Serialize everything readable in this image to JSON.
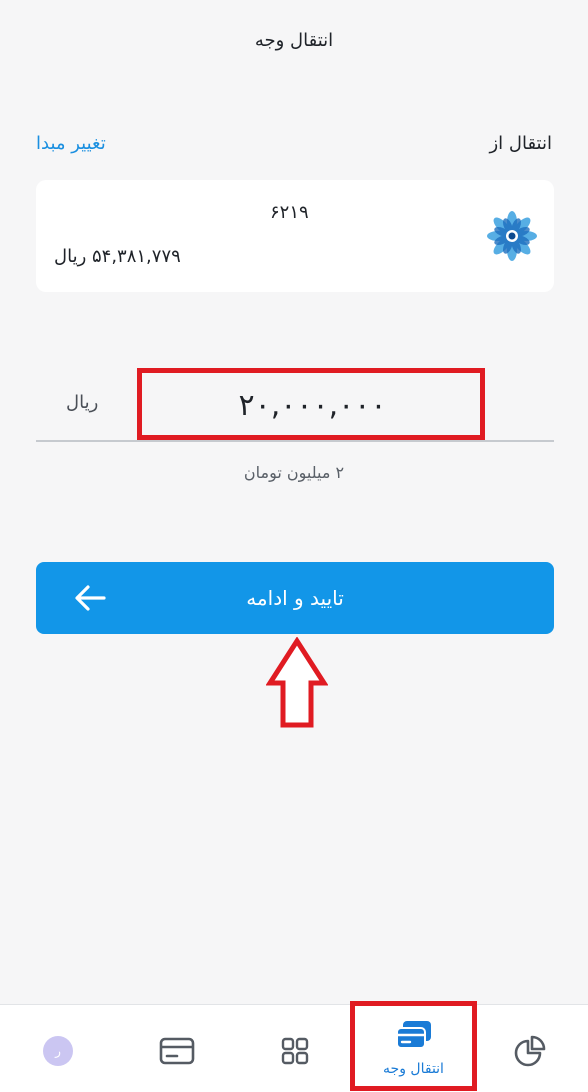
{
  "header": {
    "title": "انتقال وجه"
  },
  "source": {
    "label": "انتقال از",
    "change_link": "تغییر مبدا",
    "card": {
      "number": "۶۲۱۹",
      "balance": "۵۴,۳۸۱,۷۷۹ ریال",
      "logo_icon": "bank-flower-logo"
    }
  },
  "amount": {
    "currency": "ریال",
    "value": "۲۰,۰۰۰,۰۰۰",
    "in_words": "۲ میلیون تومان"
  },
  "confirm": {
    "label": "تایید و ادامه",
    "icon": "arrow-left-icon"
  },
  "bottom_nav": {
    "items": [
      {
        "name": "profile",
        "avatar_initial": "ر"
      },
      {
        "name": "cards",
        "icon": "card-icon"
      },
      {
        "name": "services",
        "icon": "grid-icon"
      },
      {
        "name": "transfer",
        "icon": "transfer-cards-icon",
        "label": "انتقال وجه",
        "active": true
      },
      {
        "name": "reports",
        "icon": "pie-chart-icon"
      }
    ]
  },
  "colors": {
    "accent": "#1296e8",
    "link": "#1a8fe0",
    "annotation": "#e01b22",
    "background": "#f6f6f7"
  }
}
